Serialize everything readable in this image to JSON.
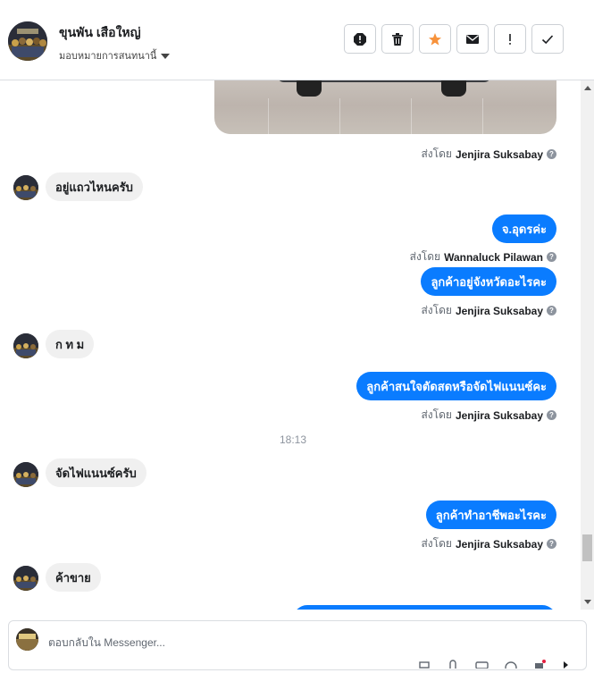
{
  "header": {
    "contact_name": "ขุนพัน เสือใหญ่",
    "assign_label": "มอบหมายการสนทนานี้",
    "actions": [
      {
        "icon": "spam-alert-icon"
      },
      {
        "icon": "trash-icon"
      },
      {
        "icon": "star-icon"
      },
      {
        "icon": "mail-icon"
      },
      {
        "icon": "exclamation-icon"
      },
      {
        "icon": "check-icon"
      }
    ]
  },
  "colors": {
    "outgoing_bubble": "#0a7cff",
    "incoming_bubble": "#f0f0f0",
    "star": "#f7923b"
  },
  "thread": {
    "image_message_sent_by_label": "ส่งโดย",
    "image_message_sent_by_name": "Jenjira Suksabay",
    "messages": [
      {
        "dir": "in",
        "text": "อยู่แถวไหนครับ"
      },
      {
        "dir": "out",
        "text": "จ.อุดรค่ะ",
        "sent_by_label": "ส่งโดย",
        "sent_by_name": "Wannaluck Pilawan"
      },
      {
        "dir": "out",
        "text": "ลูกค้าอยู่จังหวัดอะไรคะ",
        "sent_by_label": "ส่งโดย",
        "sent_by_name": "Jenjira Suksabay"
      },
      {
        "dir": "in",
        "text": "ก ท ม"
      },
      {
        "dir": "out",
        "text": "ลูกค้าสนใจตัดสดหรือจัดไฟแนนซ์คะ",
        "sent_by_label": "ส่งโดย",
        "sent_by_name": "Jenjira Suksabay"
      },
      {
        "dir": "in",
        "text": "จัดไฟแนนซ์ครับ"
      },
      {
        "dir": "out",
        "text": "ลูกค้าทำอาชีพอะไรคะ",
        "sent_by_label": "ส่งโดย",
        "sent_by_name": "Jenjira Suksabay"
      },
      {
        "dir": "in",
        "text": "ค้าขาย"
      }
    ],
    "time_separator": "18:13"
  },
  "composer": {
    "placeholder": "ตอบกลับใน Messenger..."
  }
}
